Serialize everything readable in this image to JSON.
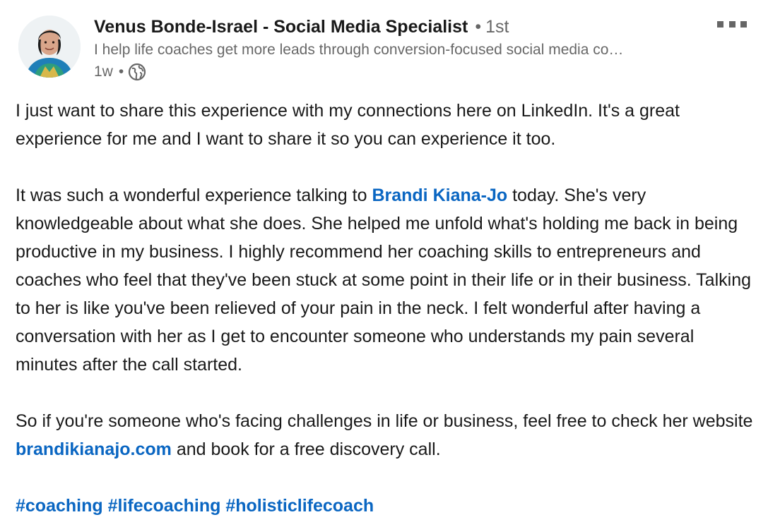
{
  "author": {
    "name": "Venus Bonde-Israel - Social Media Specialist",
    "separator": "•",
    "degree": "1st",
    "headline": "I help life coaches get more leads through conversion-focused social media co…",
    "time": "1w",
    "visibility_icon": "globe-icon"
  },
  "menu": {
    "icon": "more-options-icon"
  },
  "post": {
    "p1": "I just want to share this experience with my connections here on LinkedIn. It's a great experience for me and I want to share it so you can experience it too.",
    "p2_before": "It was such a wonderful experience talking to ",
    "p2_mention": "Brandi Kiana-Jo",
    "p2_after": " today. She's very knowledgeable about what she does. She helped me unfold what's holding me back in being productive in my business. I highly recommend her coaching skills to entrepreneurs and coaches who feel that they've been stuck at some point in their life or in their business. Talking to her is like you've been relieved of your pain in the neck. I felt wonderful after having a conversation with her as I get to encounter someone who understands my pain several minutes after the call started.",
    "p3_before": "So if you're someone who's facing challenges in life or business, feel free to check her website ",
    "p3_link": "brandikianajo.com",
    "p3_after": " and book for a free discovery call.",
    "hashtags": [
      "#coaching",
      "#lifecoaching",
      "#holisticlifecoach"
    ]
  },
  "colors": {
    "link": "#0a66c2",
    "text": "#1f1f1f",
    "muted": "#666666"
  }
}
